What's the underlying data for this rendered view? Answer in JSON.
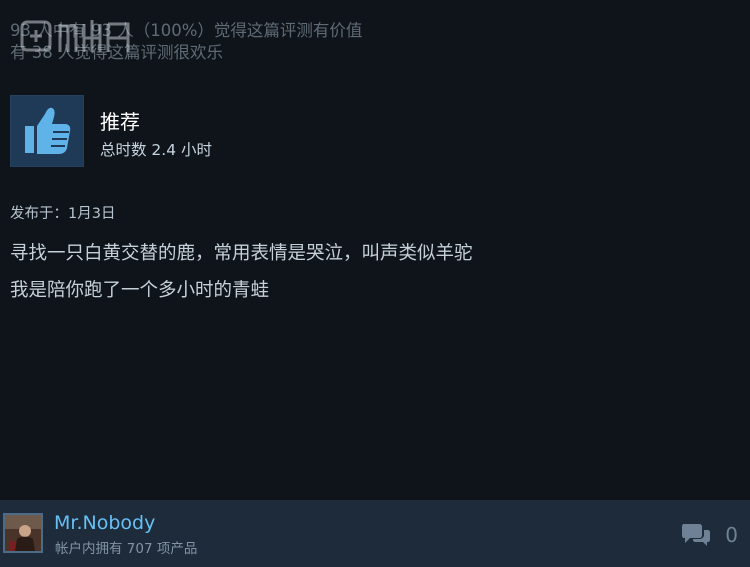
{
  "helpful": {
    "line1": "93 人中有 93 人（100%）觉得这篇评测有价值",
    "line2": "有 38 人觉得这篇评测很欢乐"
  },
  "recommendation": {
    "title": "推荐",
    "hours": "总时数 2.4 小时",
    "icon": "thumbs-up-icon",
    "accent": "#1f3a56"
  },
  "review": {
    "posted": "发布于：1月3日",
    "lines": [
      "寻找一只白黄交替的鹿，常用表情是哭泣，叫声类似羊驼",
      "我是陪你跑了一个多小时的青蛙"
    ]
  },
  "author": {
    "name": "Mr.Nobody",
    "products": "帐户内拥有 707 项产品",
    "avatar": "avatar"
  },
  "comments": {
    "icon": "comment-bubbles-icon",
    "count": "0"
  },
  "colors": {
    "background": "#0f141b",
    "footer": "#1e2b3b",
    "username": "#66c0f4"
  }
}
